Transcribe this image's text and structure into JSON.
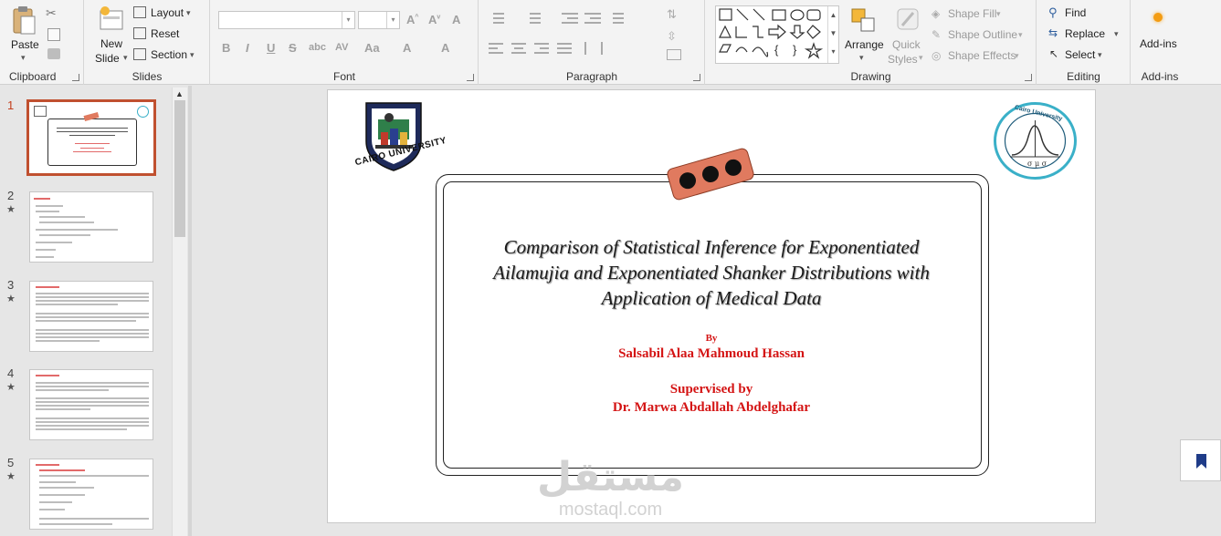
{
  "ribbon": {
    "clipboard": {
      "paste": "Paste",
      "label": "Clipboard"
    },
    "slides": {
      "new_slide_line1": "New",
      "new_slide_line2": "Slide",
      "layout": "Layout",
      "reset": "Reset",
      "section": "Section",
      "label": "Slides"
    },
    "font": {
      "label": "Font",
      "bold": "B",
      "italic": "I",
      "underline": "U",
      "strike": "S",
      "shadow": "abc",
      "spacing": "AV",
      "case": "Aa",
      "clear": "A",
      "color": "A"
    },
    "paragraph": {
      "label": "Paragraph"
    },
    "drawing": {
      "arrange": "Arrange",
      "quick_styles_line1": "Quick",
      "quick_styles_line2": "Styles",
      "shape_fill": "Shape Fill",
      "shape_outline": "Shape Outline",
      "shape_effects": "Shape Effects",
      "label": "Drawing"
    },
    "editing": {
      "find": "Find",
      "replace": "Replace",
      "select": "Select",
      "label": "Editing"
    },
    "addins": {
      "button": "Add-ins",
      "label": "Add-ins"
    }
  },
  "thumbnails": [
    {
      "number": "1",
      "star": ""
    },
    {
      "number": "2",
      "star": "★"
    },
    {
      "number": "3",
      "star": "★"
    },
    {
      "number": "4",
      "star": "★"
    },
    {
      "number": "5",
      "star": "★"
    }
  ],
  "slide": {
    "logo_left_text": "CAIRO UNIVERSITY",
    "logo_right_text": "Cairo University",
    "title_line1": "Comparison of Statistical Inference for Exponentiated",
    "title_line2": "Ailamujia and Exponentiated Shanker Distributions with",
    "title_line3": "Application of Medical Data",
    "by": "By",
    "author": "Salsabil Alaa Mahmoud Hassan",
    "supervised": "Supervised by",
    "supervisor": "Dr. Marwa Abdallah Abdelghafar"
  },
  "watermark": {
    "arabic": "مستقل",
    "latin": "mostaql.com"
  },
  "colors": {
    "accent": "#c43e1c",
    "slide_red": "#d41414",
    "badge": "#e07a5f"
  }
}
